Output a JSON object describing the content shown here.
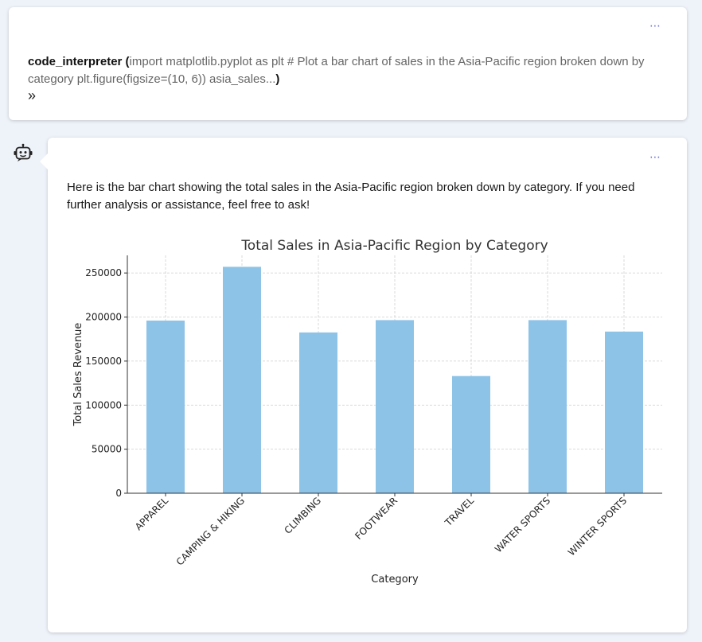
{
  "tool_call": {
    "more_label": "⋯",
    "name": "code_interpreter",
    "open_paren": " (",
    "args": "import matplotlib.pyplot as plt # Plot a bar chart of sales in the Asia-Pacific region broken down by category plt.figure(figsize=(10, 6)) asia_sales...",
    "close_paren": ")",
    "expand_icon": "double-chevron-right"
  },
  "assistant": {
    "avatar_icon": "robot",
    "more_label": "⋯",
    "message": "Here is the bar chart showing the total sales in the Asia-Pacific region broken down by category. If you need further analysis or assistance, feel free to ask!"
  },
  "colors": {
    "bar": "#8ec3e8",
    "accent": "#6a6fd6"
  },
  "chart_data": {
    "type": "bar",
    "title": "Total Sales in Asia-Pacific Region by Category",
    "xlabel": "Category",
    "ylabel": "Total Sales Revenue",
    "categories": [
      "APPAREL",
      "CAMPING & HIKING",
      "CLIMBING",
      "FOOTWEAR",
      "TRAVEL",
      "WATER SPORTS",
      "WINTER SPORTS"
    ],
    "values": [
      196000,
      257000,
      182500,
      196500,
      133000,
      196500,
      183500
    ],
    "yticks": [
      0,
      50000,
      100000,
      150000,
      200000,
      250000
    ],
    "ylim": [
      0,
      270000
    ],
    "grid": true
  }
}
